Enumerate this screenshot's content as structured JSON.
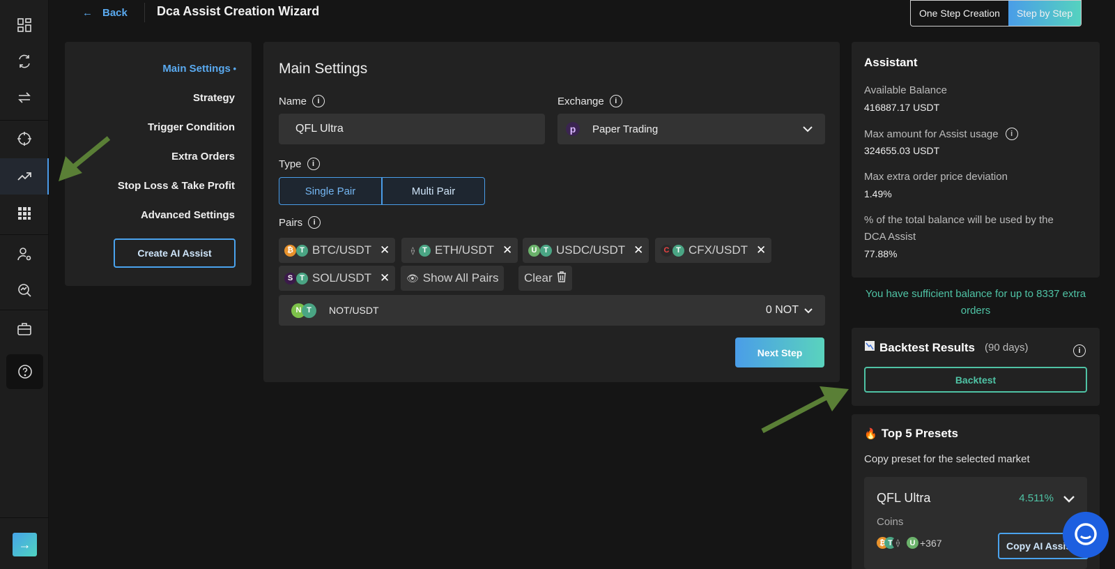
{
  "header": {
    "back_label": "Back",
    "title": "Dca Assist Creation Wizard",
    "modes": [
      "One Step Creation",
      "Step by Step"
    ]
  },
  "steps": {
    "items": [
      "Main Settings",
      "Strategy",
      "Trigger Condition",
      "Extra Orders",
      "Stop Loss & Take Profit",
      "Advanced Settings"
    ],
    "create_button": "Create AI Assist"
  },
  "main": {
    "title": "Main Settings",
    "name_label": "Name",
    "name_value": "QFL Ultra",
    "exchange_label": "Exchange",
    "exchange_value": "Paper Trading",
    "type_label": "Type",
    "type_options": [
      "Single Pair",
      "Multi Pair"
    ],
    "pairs_label": "Pairs",
    "pairs": [
      "BTC/USDT",
      "ETH/USDT",
      "USDC/USDT",
      "CFX/USDT",
      "SOL/USDT"
    ],
    "show_all": "Show All Pairs",
    "clear": "Clear",
    "selected_pair": "NOT/USDT",
    "selected_amount": "0 NOT",
    "next_button": "Next Step"
  },
  "assistant": {
    "title": "Assistant",
    "available_label": "Available Balance",
    "available_value": "416887.17 USDT",
    "max_amount_label": "Max amount for Assist usage",
    "max_amount_value": "324655.03 USDT",
    "deviation_label": "Max extra order price deviation",
    "deviation_value": "1.49%",
    "pct_label_1": "% of the total balance will be used by the",
    "pct_label_2": "DCA Assist",
    "pct_value": "77.88%",
    "sufficient_1": "You have sufficient balance for up to 8337 extra",
    "sufficient_2": "orders"
  },
  "backtest": {
    "title": "Backtest Results",
    "period": "(90 days)",
    "button": "Backtest"
  },
  "presets": {
    "title": "Top 5 Presets",
    "subtitle": "Copy preset for the selected market",
    "card_name": "QFL Ultra",
    "card_pct": "4.511%",
    "coins_label": "Coins",
    "coins_more": "+367",
    "copy_button": "Copy AI Assist"
  },
  "colors": {
    "accent_blue": "#4a9de8",
    "accent_teal": "#4fc3a5",
    "annotation_arrow": "#5a7f36"
  }
}
